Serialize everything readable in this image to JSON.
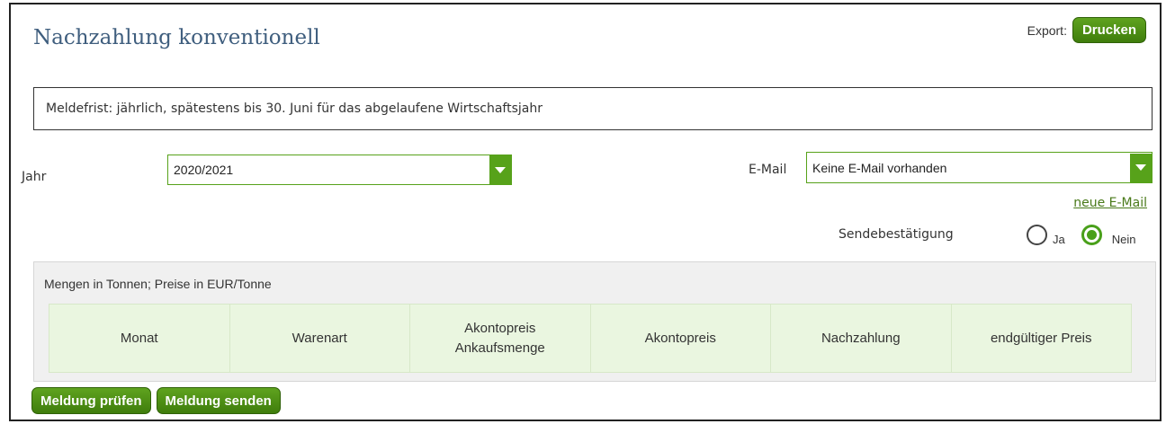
{
  "page": {
    "title": "Nachzahlung konventionell"
  },
  "export": {
    "label": "Export:",
    "print_button": "Drucken"
  },
  "notice": "Meldefrist: jährlich, spätestens bis 30. Juni für das abgelaufene Wirtschaftsjahr",
  "year": {
    "label": "Jahr",
    "value": "2020/2021"
  },
  "email": {
    "label": "E-Mail",
    "value": "Keine E-Mail vorhanden",
    "new_link": "neue E-Mail"
  },
  "confirmation": {
    "label": "Sendebestätigung",
    "options": [
      {
        "label": "Ja",
        "selected": false
      },
      {
        "label": "Nein",
        "selected": true
      }
    ]
  },
  "table": {
    "caption": "Mengen in Tonnen; Preise in EUR/Tonne",
    "columns": [
      "Monat",
      "Warenart",
      "Akontopreis Ankaufsmenge",
      "Akontopreis",
      "Nachzahlung",
      "endgültiger Preis"
    ]
  },
  "actions": {
    "check": "Meldung prüfen",
    "send": "Meldung senden"
  },
  "colors": {
    "accent": "#57a21a",
    "title": "#3f5e7e",
    "table_header_bg": "#eaf6e0"
  },
  "icons": {
    "dropdown": "chevron-down-icon"
  }
}
